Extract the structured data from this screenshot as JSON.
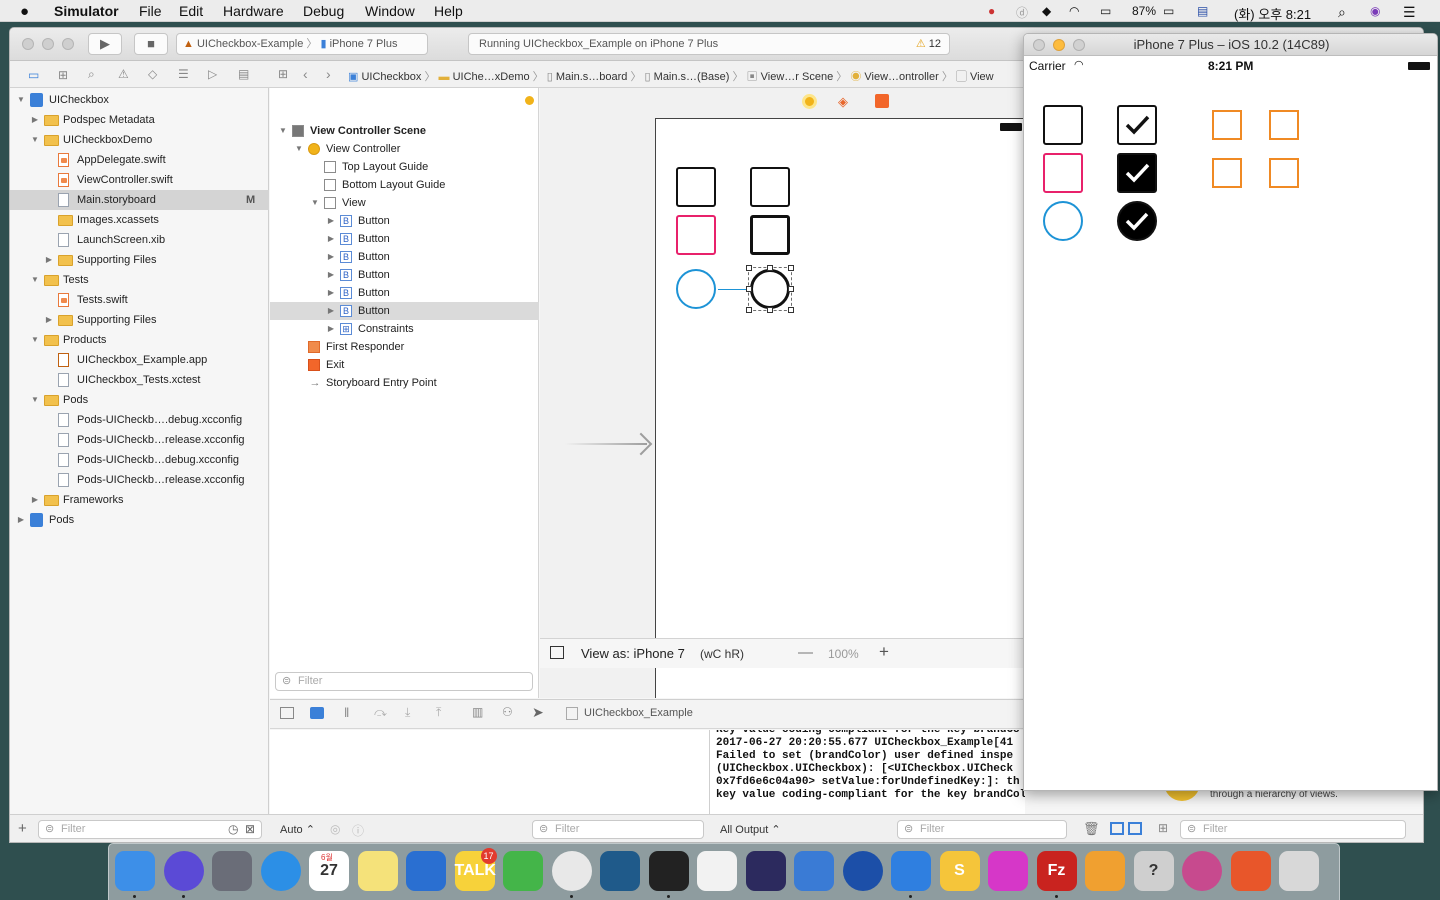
{
  "menubar": {
    "apple": "",
    "items": [
      "Simulator",
      "File",
      "Edit",
      "Hardware",
      "Debug",
      "Window",
      "Help"
    ],
    "battery": "87%",
    "datetime": "(화) 오후 8:21"
  },
  "toolbar": {
    "scheme": "UICheckbox-Example",
    "device": "iPhone 7 Plus",
    "status": "Running UICheckbox_Example on iPhone 7 Plus",
    "warnings": "12"
  },
  "jumpbar": {
    "crumbs": [
      "UICheckbox",
      "UIChe…xDemo",
      "Main.s…board",
      "Main.s…(Base)",
      "View…r Scene",
      "View…ontroller",
      "View"
    ]
  },
  "navigator": {
    "rows": [
      {
        "label": "UICheckbox",
        "type": "project",
        "indent": 0,
        "open": true
      },
      {
        "label": "Podspec Metadata",
        "type": "folder",
        "indent": 1,
        "open": false
      },
      {
        "label": "UICheckboxDemo",
        "type": "folder",
        "indent": 1,
        "open": true
      },
      {
        "label": "AppDelegate.swift",
        "type": "swift",
        "indent": 2
      },
      {
        "label": "ViewController.swift",
        "type": "swift",
        "indent": 2
      },
      {
        "label": "Main.storyboard",
        "type": "file",
        "indent": 2,
        "selected": true,
        "badge": "M"
      },
      {
        "label": "Images.xcassets",
        "type": "folder",
        "indent": 2
      },
      {
        "label": "LaunchScreen.xib",
        "type": "file",
        "indent": 2
      },
      {
        "label": "Supporting Files",
        "type": "folder",
        "indent": 2,
        "open": false
      },
      {
        "label": "Tests",
        "type": "folder",
        "indent": 1,
        "open": true
      },
      {
        "label": "Tests.swift",
        "type": "swift",
        "indent": 2
      },
      {
        "label": "Supporting Files",
        "type": "folder",
        "indent": 2,
        "open": false
      },
      {
        "label": "Products",
        "type": "folder",
        "indent": 1,
        "open": true
      },
      {
        "label": "UICheckbox_Example.app",
        "type": "app",
        "indent": 2
      },
      {
        "label": "UICheckbox_Tests.xctest",
        "type": "file",
        "indent": 2
      },
      {
        "label": "Pods",
        "type": "folder",
        "indent": 1,
        "open": true
      },
      {
        "label": "Pods-UICheckb….debug.xcconfig",
        "type": "file",
        "indent": 2
      },
      {
        "label": "Pods-UICheckb…release.xcconfig",
        "type": "file",
        "indent": 2
      },
      {
        "label": "Pods-UICheckb…debug.xcconfig",
        "type": "file",
        "indent": 2
      },
      {
        "label": "Pods-UICheckb…release.xcconfig",
        "type": "file",
        "indent": 2
      },
      {
        "label": "Frameworks",
        "type": "folder",
        "indent": 1,
        "open": false
      },
      {
        "label": "Pods",
        "type": "project",
        "indent": 0,
        "open": false
      }
    ],
    "filter_placeholder": "Filter"
  },
  "outline": {
    "rows": [
      {
        "label": "View Controller Scene",
        "icon": "scene",
        "indent": 0,
        "open": true,
        "bold": true
      },
      {
        "label": "View Controller",
        "icon": "vc",
        "indent": 1,
        "open": true
      },
      {
        "label": "Top Layout Guide",
        "icon": "view",
        "indent": 2
      },
      {
        "label": "Bottom Layout Guide",
        "icon": "view",
        "indent": 2
      },
      {
        "label": "View",
        "icon": "view",
        "indent": 2,
        "open": true
      },
      {
        "label": "Button",
        "icon": "button",
        "indent": 3,
        "open": false
      },
      {
        "label": "Button",
        "icon": "button",
        "indent": 3,
        "open": false
      },
      {
        "label": "Button",
        "icon": "button",
        "indent": 3,
        "open": false
      },
      {
        "label": "Button",
        "icon": "button",
        "indent": 3,
        "open": false
      },
      {
        "label": "Button",
        "icon": "button",
        "indent": 3,
        "open": false
      },
      {
        "label": "Button",
        "icon": "button",
        "indent": 3,
        "open": false,
        "selected": true
      },
      {
        "label": "Constraints",
        "icon": "constraints",
        "indent": 3,
        "open": false
      },
      {
        "label": "First Responder",
        "icon": "responder",
        "indent": 1
      },
      {
        "label": "Exit",
        "icon": "exit",
        "indent": 1
      },
      {
        "label": "Storyboard Entry Point",
        "icon": "arrow",
        "indent": 1
      }
    ],
    "filter_placeholder": "Filter"
  },
  "editor": {
    "view_as": "View as: iPhone 7",
    "size_class": "(wC hR)",
    "zoom": "100%"
  },
  "debug": {
    "target": "UICheckbox_Example",
    "auto": "Auto",
    "output": "All Output",
    "filter_placeholder": "Filter",
    "console_lines": [
      "Key value coding-compliant for the key brandCo",
      "2017-06-27 20:20:55.677 UICheckbox_Example[41",
      "Failed to set (brandColor) user defined inspe",
      "(UICheckbox.UICheckbox): [<UICheckbox.UICheck",
      "0x7fd6e6c04a90> setValue:forUndefinedKey:]: th",
      "key value coding-compliant for the key brandColor."
    ]
  },
  "simulator": {
    "title": "iPhone 7 Plus – iOS 10.2 (14C89)",
    "carrier": "Carrier",
    "time": "8:21 PM"
  },
  "utilities": {
    "tip": "through a hierarchy of views."
  },
  "colors": {
    "pink": "#e8216b",
    "blue": "#1d93d6",
    "orange": "#f08a24",
    "selection": "#d4d4d4"
  },
  "dock": {
    "apps": [
      "finder-icon",
      "siri-icon",
      "launchpad-icon",
      "safari-icon",
      "calendar-icon",
      "notes-icon",
      "keynote-icon",
      "kakaotalk-icon",
      "evernote-icon",
      "chrome-icon",
      "sourcetree-icon",
      "terminal-icon",
      "textedit-icon",
      "eclipse-icon",
      "instruments-icon",
      "quicktime-icon",
      "xcode-icon",
      "sketch-icon",
      "flower-icon",
      "filezilla-icon",
      "dash-icon",
      "help-icon",
      "sierra-icon",
      "paw-icon",
      "trash-icon"
    ],
    "calendar_day": "27",
    "calendar_month": "6월",
    "talk_label": "TALK",
    "talk_badge": "17",
    "fz_label": "Fz",
    "sketch_label": "S",
    "help_label": "?"
  }
}
